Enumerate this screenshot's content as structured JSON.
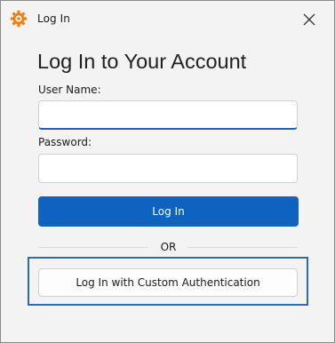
{
  "window": {
    "title": "Log In",
    "app_icon": "gear-app-icon",
    "close_icon": "close-icon"
  },
  "form": {
    "heading": "Log In to Your Account",
    "username_label": "User Name:",
    "username_value": "",
    "password_label": "Password:",
    "password_value": "",
    "login_button": "Log In",
    "separator_text": "OR",
    "custom_auth_button": "Log In with Custom Authentication"
  },
  "colors": {
    "accent": "#0d63bf",
    "app_icon": "#f07f14",
    "highlight_border": "#2f6bb0",
    "window_background": "#f3f3f3"
  }
}
